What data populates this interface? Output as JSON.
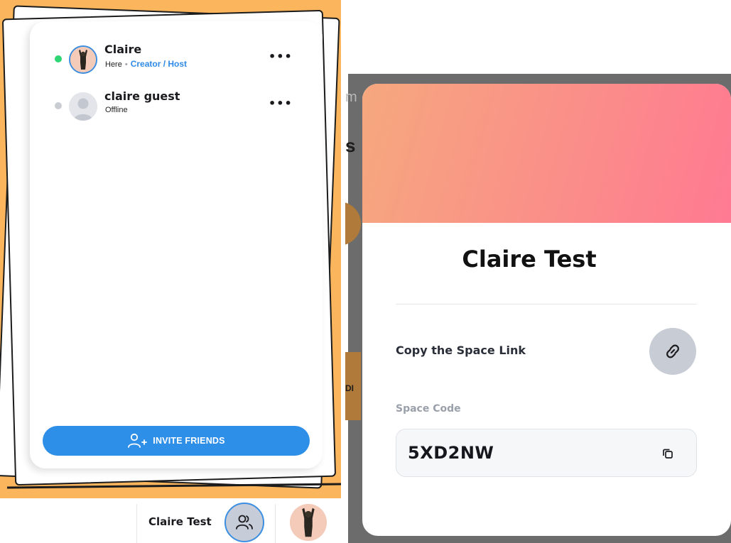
{
  "participants": {
    "members": [
      {
        "name": "Claire",
        "status": "Here",
        "role": "Creator / Host",
        "online": true
      },
      {
        "name": "claire guest",
        "status": "Offline",
        "online": false
      }
    ],
    "more_label": "•••",
    "invite_label": "INVITE FRIENDS"
  },
  "bottom_bar": {
    "space_name": "Claire Test"
  },
  "background_peek": {
    "top_text": "m",
    "mid_text": "s",
    "block_text": "DI"
  },
  "space_card": {
    "title": "Claire Test",
    "copy_link_label": "Copy the Space Link",
    "space_code_label": "Space Code",
    "space_code": "5XD2NW"
  },
  "colors": {
    "accent_blue": "#2E8FE8",
    "online_green": "#2ED573",
    "offline_gray": "#C9CDD3",
    "page_orange": "#FBB55C",
    "banner_from": "#F6A87E",
    "banner_to": "#FF7A92"
  },
  "icons": {
    "avatar_claire": "silhouette-photo-icon",
    "avatar_guest": "default-user-icon",
    "invite": "add-user-icon",
    "people": "people-icon",
    "copy_link": "link-icon",
    "copy_code": "copy-icon"
  }
}
